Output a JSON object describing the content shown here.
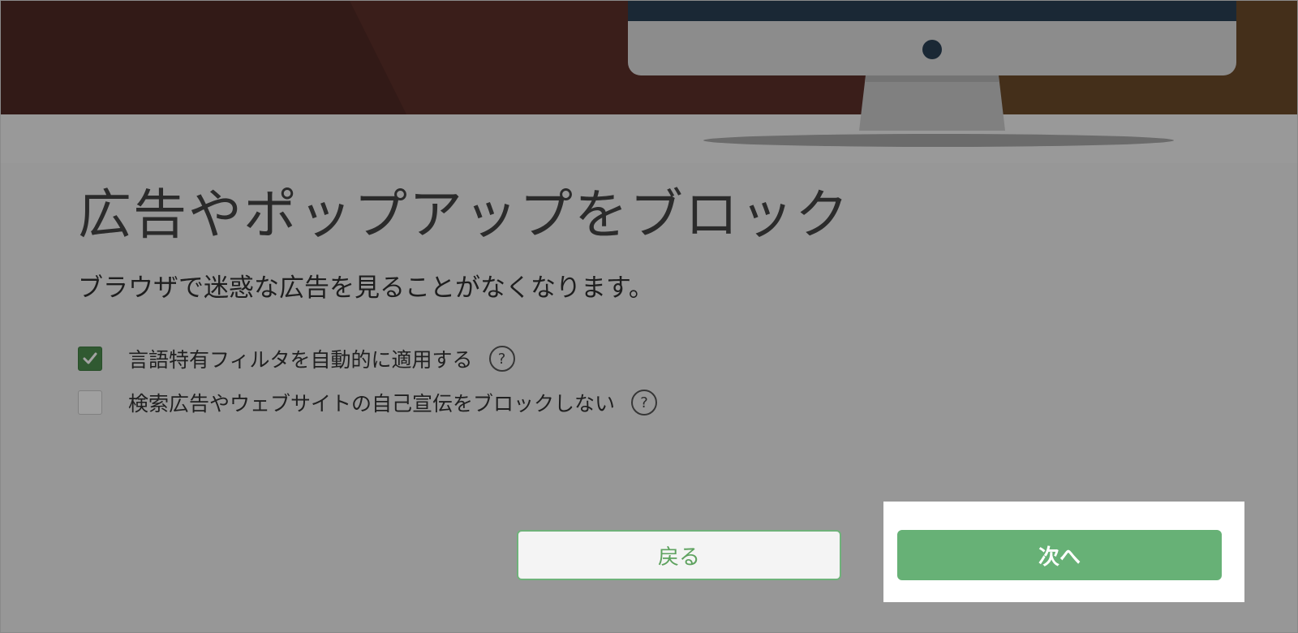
{
  "dialog": {
    "title": "広告やポップアップをブロック",
    "subtitle": "ブラウザで迷惑な広告を見ることがなくなります。",
    "options": [
      {
        "label": "言語特有フィルタを自動的に適用する",
        "checked": true
      },
      {
        "label": "検索広告やウェブサイトの自己宣伝をブロックしない",
        "checked": false
      }
    ],
    "help_glyph": "?",
    "back_label": "戻る",
    "next_label": "次へ"
  },
  "colors": {
    "accent": "#67b176",
    "checkbox_checked": "#4c8c4e",
    "overlay": "rgba(0,0,0,0.36)"
  },
  "icons": {
    "check": "checkmark-icon",
    "help": "question-circle-icon",
    "illustration": "monitor-illustration"
  }
}
